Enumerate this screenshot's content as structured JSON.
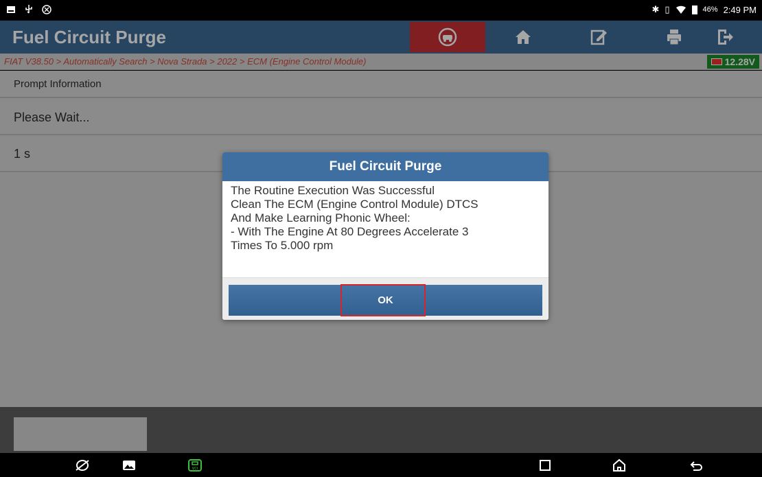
{
  "status_bar": {
    "battery_percent": "46%",
    "time": "2:49 PM",
    "left_icons": [
      "notification-square-icon",
      "usb-icon",
      "signal-app-icon"
    ],
    "right_icons": [
      "bluetooth-icon",
      "vibrate-icon",
      "wifi-icon",
      "battery-icon"
    ]
  },
  "header": {
    "title": "Fuel Circuit Purge",
    "buttons": [
      {
        "name": "vehicle-diagnose-button",
        "icon": "car-steering-icon",
        "active": true
      },
      {
        "name": "home-button",
        "icon": "home-icon"
      },
      {
        "name": "edit-button",
        "icon": "edit-icon"
      },
      {
        "name": "print-button",
        "icon": "printer-icon"
      },
      {
        "name": "exit-button",
        "icon": "exit-icon"
      }
    ]
  },
  "breadcrumb": {
    "text": "FIAT V38.50 > Automatically Search > Nova Strada > 2022 > ECM (Engine Control Module)",
    "voltage": "12.28V"
  },
  "content": {
    "section_label": "Prompt Information",
    "message": "Please Wait...",
    "timer": "1 s"
  },
  "dialog": {
    "title": "Fuel Circuit Purge",
    "lines": [
      "The Routine Execution Was Successful",
      "Clean The ECM (Engine Control Module) DTCS",
      "And Make Learning Phonic Wheel:",
      "- With The Engine At 80 Degrees Accelerate 3",
      "Times To 5.000 rpm"
    ],
    "ok_label": "OK"
  },
  "colors": {
    "header_bg": "#3d6b95",
    "active_button": "#c62f33",
    "breadcrumb_text": "#d04a3a",
    "voltage_bg": "#1b8a2c",
    "highlight": "#d4262c",
    "vci_green": "#3cc13c"
  },
  "nav_bar": {
    "icons": [
      "browser-icon",
      "gallery-icon",
      "vci-icon",
      "recents-icon",
      "home-nav-icon",
      "back-icon"
    ]
  }
}
